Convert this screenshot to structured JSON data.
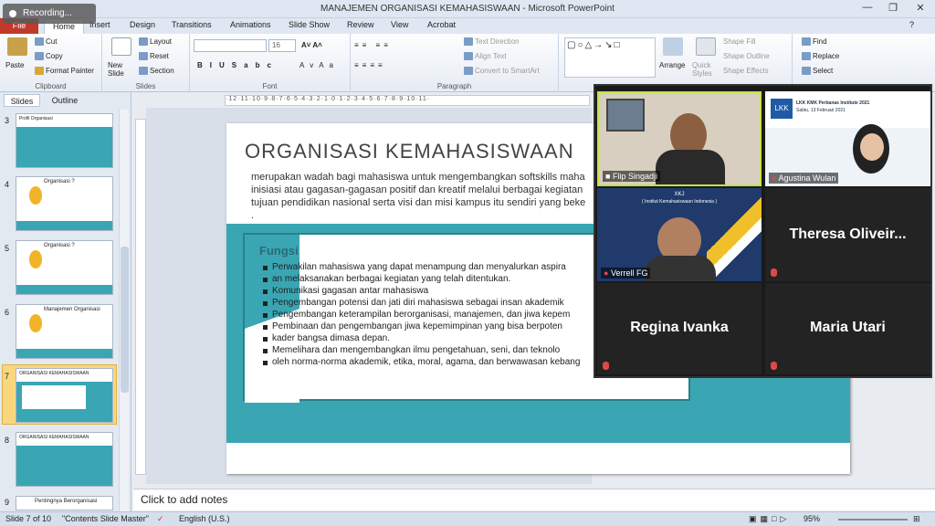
{
  "window": {
    "title": "MANAJEMEN ORGANISASI KEMAHASISWAAN  -  Microsoft PowerPoint",
    "recording": "Recording..."
  },
  "tabs": {
    "file": "File",
    "home": "Home",
    "others": [
      "Insert",
      "Design",
      "Transitions",
      "Animations",
      "Slide Show",
      "Review",
      "View",
      "Acrobat"
    ]
  },
  "ribbon": {
    "clipboard": {
      "paste": "Paste",
      "cut": "Cut",
      "copy": "Copy",
      "format_painter": "Format Painter",
      "label": "Clipboard"
    },
    "slides": {
      "new_slide": "New Slide",
      "layout": "Layout",
      "reset": "Reset",
      "section": "Section",
      "label": "Slides"
    },
    "font": {
      "size": "16",
      "label": "Font"
    },
    "paragraph": {
      "text_direction": "Text Direction",
      "align_text": "Align Text",
      "smartart": "Convert to SmartArt",
      "label": "Paragraph"
    },
    "drawing": {
      "arrange": "Arrange",
      "quick_styles": "Quick Styles",
      "shape_fill": "Shape Fill",
      "shape_outline": "Shape Outline",
      "shape_effects": "Shape Effects"
    },
    "editing": {
      "find": "Find",
      "replace": "Replace",
      "select": "Select"
    }
  },
  "panel": {
    "slides_tab": "Slides",
    "outline_tab": "Outline",
    "thumbs": [
      {
        "num": "3",
        "title": "Profil Organisasi"
      },
      {
        "num": "4",
        "title": "Organisasi ?"
      },
      {
        "num": "5",
        "title": "Organisasi ?"
      },
      {
        "num": "6",
        "title": "Manajemen Organisasi"
      },
      {
        "num": "7",
        "title": "ORGANISASI KEMAHASISWAAN"
      },
      {
        "num": "8",
        "title": "ORGANISASI KEMAHASISWAAN"
      },
      {
        "num": "9",
        "title": "Pentingnya Berorganisasi"
      }
    ]
  },
  "slide": {
    "title": "ORGANISASI  KEMAHASISWAAN",
    "intro_lines": [
      "merupakan wadah bagi mahasiswa untuk mengembangkan softskills maha",
      "inisiasi atau gagasan-gagasan  positif dan kreatif  melalui berbagai kegiatan",
      "tujuan pendidikan nasional serta visi dan misi kampus itu sendiri yang beke",
      "."
    ],
    "fungsi": "Fungsi",
    "bullets": [
      "Perwakilan mahasiswa yang dapat menampung dan menyalurkan aspira",
      "an melaksanakan berbagai kegiatan yang telah ditentukan.",
      "Komunikasi gagasan antar mahasiswa",
      "Pengembangan potensi dan jati diri mahasiswa sebagai insan akademik",
      "Pengembangan keterampilan berorganisasi, manajemen, dan jiwa kepem",
      "Pembinaan dan pengembangan jiwa kepemimpinan yang bisa berpoten",
      "kader bangsa dimasa depan.",
      "Memelihara dan mengembangkan ilmu pengetahuan, seni, dan teknolo",
      "oleh norma-norma akademik, etika, moral, agama, dan berwawasan kebang"
    ]
  },
  "notes": "Click to add notes",
  "status": {
    "slide": "Slide 7 of 10",
    "theme": "\"Contents Slide Master\"",
    "lang": "English (U.S.)",
    "zoom": "95%"
  },
  "meeting": {
    "participants": [
      {
        "name": "Flip Singadji"
      },
      {
        "name": "Agustina Wulan",
        "banner": "LKK KMK Perbanas Institute 2021",
        "date": "Sabtu, 13 Februari 2021"
      },
      {
        "name": "Verrell FG",
        "banner": "XKJ",
        "sub": "( Institut Kemahasiswaan Indonesia )"
      },
      {
        "name": "Theresa  Oliveir..."
      },
      {
        "name": "Regina Ivanka"
      },
      {
        "name": "Maria Utari"
      }
    ]
  },
  "colors": {
    "accent": "#3aa6b3",
    "file_tab": "#c0392b"
  }
}
